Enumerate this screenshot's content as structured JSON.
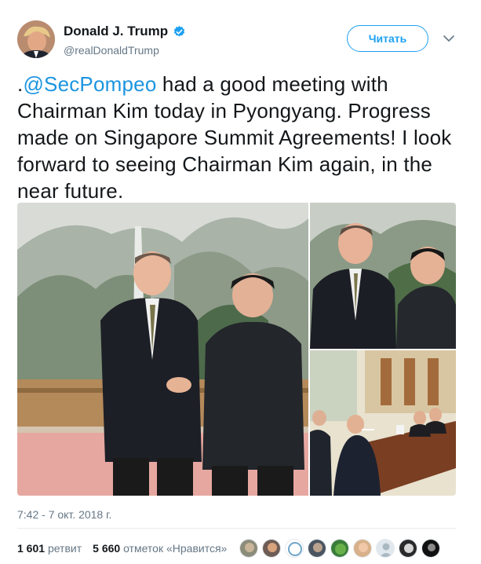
{
  "author": {
    "display_name": "Donald J. Trump",
    "handle": "@realDonaldTrump",
    "verified": true
  },
  "follow_label": "Читать",
  "tweet": {
    "prefix": ".",
    "mention": "@SecPompeo",
    "text": " had a good meeting with Chairman Kim today in Pyongyang. Progress made on Singapore Summit Agreements! I look forward to seeing Chairman Kim again, in the near future."
  },
  "timestamp": "7:42 - 7 окт. 2018 г.",
  "stats": {
    "retweets_count": "1 601",
    "retweets_label": "ретвит",
    "likes_count": "5 660",
    "likes_label": "отметок «Нравится»"
  },
  "colors": {
    "accent": "#1da1f2",
    "mention": "#1b95e0",
    "secondary_text": "#657786"
  }
}
